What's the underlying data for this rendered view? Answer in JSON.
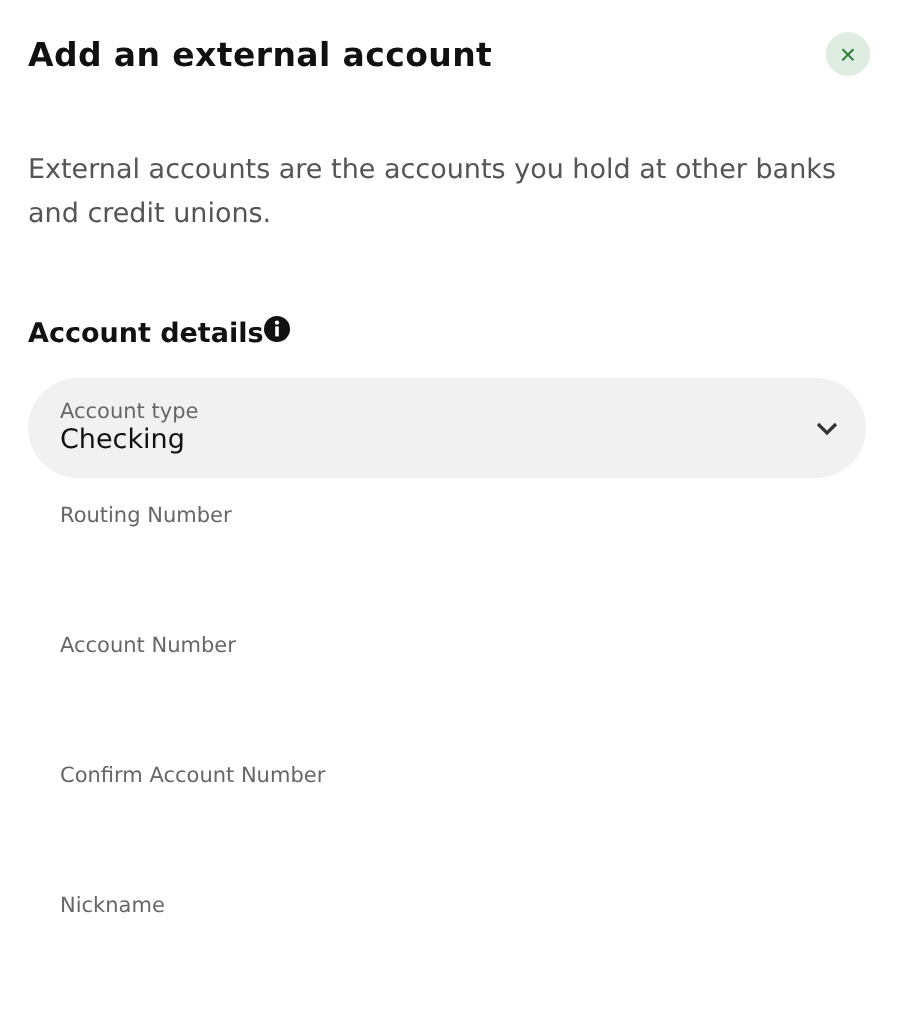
{
  "dialog": {
    "title": "Add an external account",
    "close_button": "×",
    "description": "External accounts are the accounts you hold at other banks and credit unions."
  },
  "section": {
    "title": "Account details"
  },
  "fields": [
    {
      "kind": "select",
      "label": "Account type",
      "value": "Checking"
    },
    {
      "kind": "text",
      "placeholder": "Routing Number"
    },
    {
      "kind": "text",
      "placeholder": "Account Number"
    },
    {
      "kind": "text",
      "placeholder": "Confirm Account Number"
    },
    {
      "kind": "text",
      "placeholder": "Nickname"
    }
  ]
}
